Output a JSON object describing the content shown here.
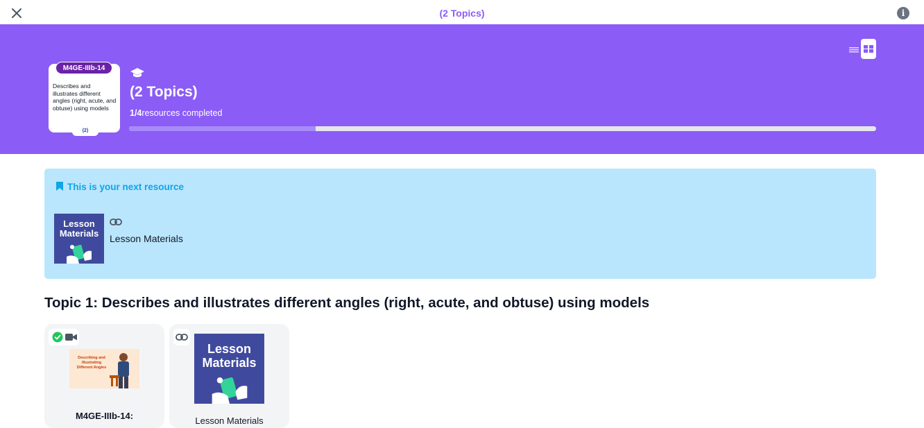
{
  "topbar": {
    "title": "(2 Topics)",
    "close_icon": "close-icon",
    "info_icon": "info-icon",
    "info_glyph": "i"
  },
  "hero": {
    "standard_code": "M4GE-IIIb-14",
    "standard_description": "Describes and illustrates different angles (right, acute, and obtuse) using models",
    "standard_count": "(2)",
    "title": "(2 Topics)",
    "progress_done": "1/4",
    "progress_suffix": "resources completed",
    "progress_fraction": 0.25,
    "view_icons": [
      "list-view-icon",
      "grid-view-icon"
    ]
  },
  "next_resource": {
    "label": "This is your next resource",
    "thumbnail_text_line1": "Lesson",
    "thumbnail_text_line2": "Materials",
    "type_icon": "link-icon",
    "resource_label": "Lesson Materials"
  },
  "topic": {
    "heading": "Topic 1: Describes and illustrates different angles (right, acute, and obtuse) using models",
    "cards": [
      {
        "type_icon": "video-icon",
        "status_icon": "check-circle-icon",
        "thumbnail_text": "Describing and Illustrating Different Angles",
        "title": "M4GE-IIIb-14:"
      },
      {
        "type_icon": "link-icon",
        "thumbnail_text_line1": "Lesson",
        "thumbnail_text_line2": "Materials",
        "title": "Lesson Materials"
      }
    ]
  },
  "colors": {
    "brand": "#8b5cf6",
    "next_box": "#bae6fd",
    "next_label": "#0ea5e9",
    "thumb_bg": "#3f4a9e",
    "success": "#22c55e"
  }
}
